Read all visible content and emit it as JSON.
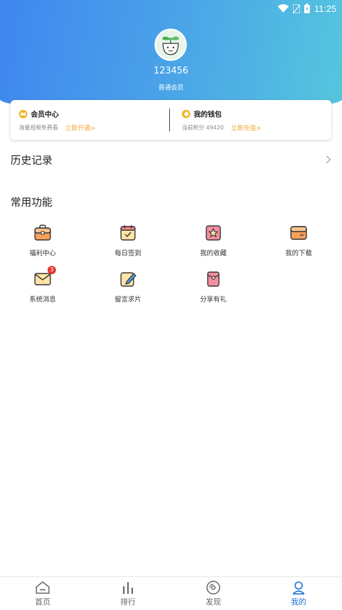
{
  "status_bar": {
    "time": "11:25"
  },
  "profile": {
    "username": "123456",
    "level": "普通会员"
  },
  "member_card": {
    "vip": {
      "title": "会员中心",
      "subtitle": "海量视频免费看",
      "link": "立即开通>"
    },
    "wallet": {
      "title": "我的钱包",
      "subtitle": "当前积分 49420",
      "link": "立即充值>"
    }
  },
  "history": {
    "label": "历史记录"
  },
  "functions": {
    "title": "常用功能",
    "items": [
      {
        "label": "福利中心",
        "icon": "gift-box-icon"
      },
      {
        "label": "每日签到",
        "icon": "calendar-check-icon"
      },
      {
        "label": "我的收藏",
        "icon": "star-icon"
      },
      {
        "label": "我的下载",
        "icon": "download-folder-icon"
      },
      {
        "label": "系统消息",
        "icon": "mail-icon",
        "badge": "3"
      },
      {
        "label": "留言求片",
        "icon": "edit-note-icon"
      },
      {
        "label": "分享有礼",
        "icon": "red-envelope-icon"
      }
    ]
  },
  "tabbar": {
    "tabs": [
      {
        "label": "首页",
        "icon": "home-icon"
      },
      {
        "label": "排行",
        "icon": "bar-chart-icon"
      },
      {
        "label": "发现",
        "icon": "disc-icon"
      },
      {
        "label": "我的",
        "icon": "user-icon",
        "active": true
      }
    ]
  },
  "colors": {
    "accent": "#1e6ed8",
    "link": "#f0a830",
    "header_start": "#3f86f0",
    "header_end": "#55c6de"
  }
}
